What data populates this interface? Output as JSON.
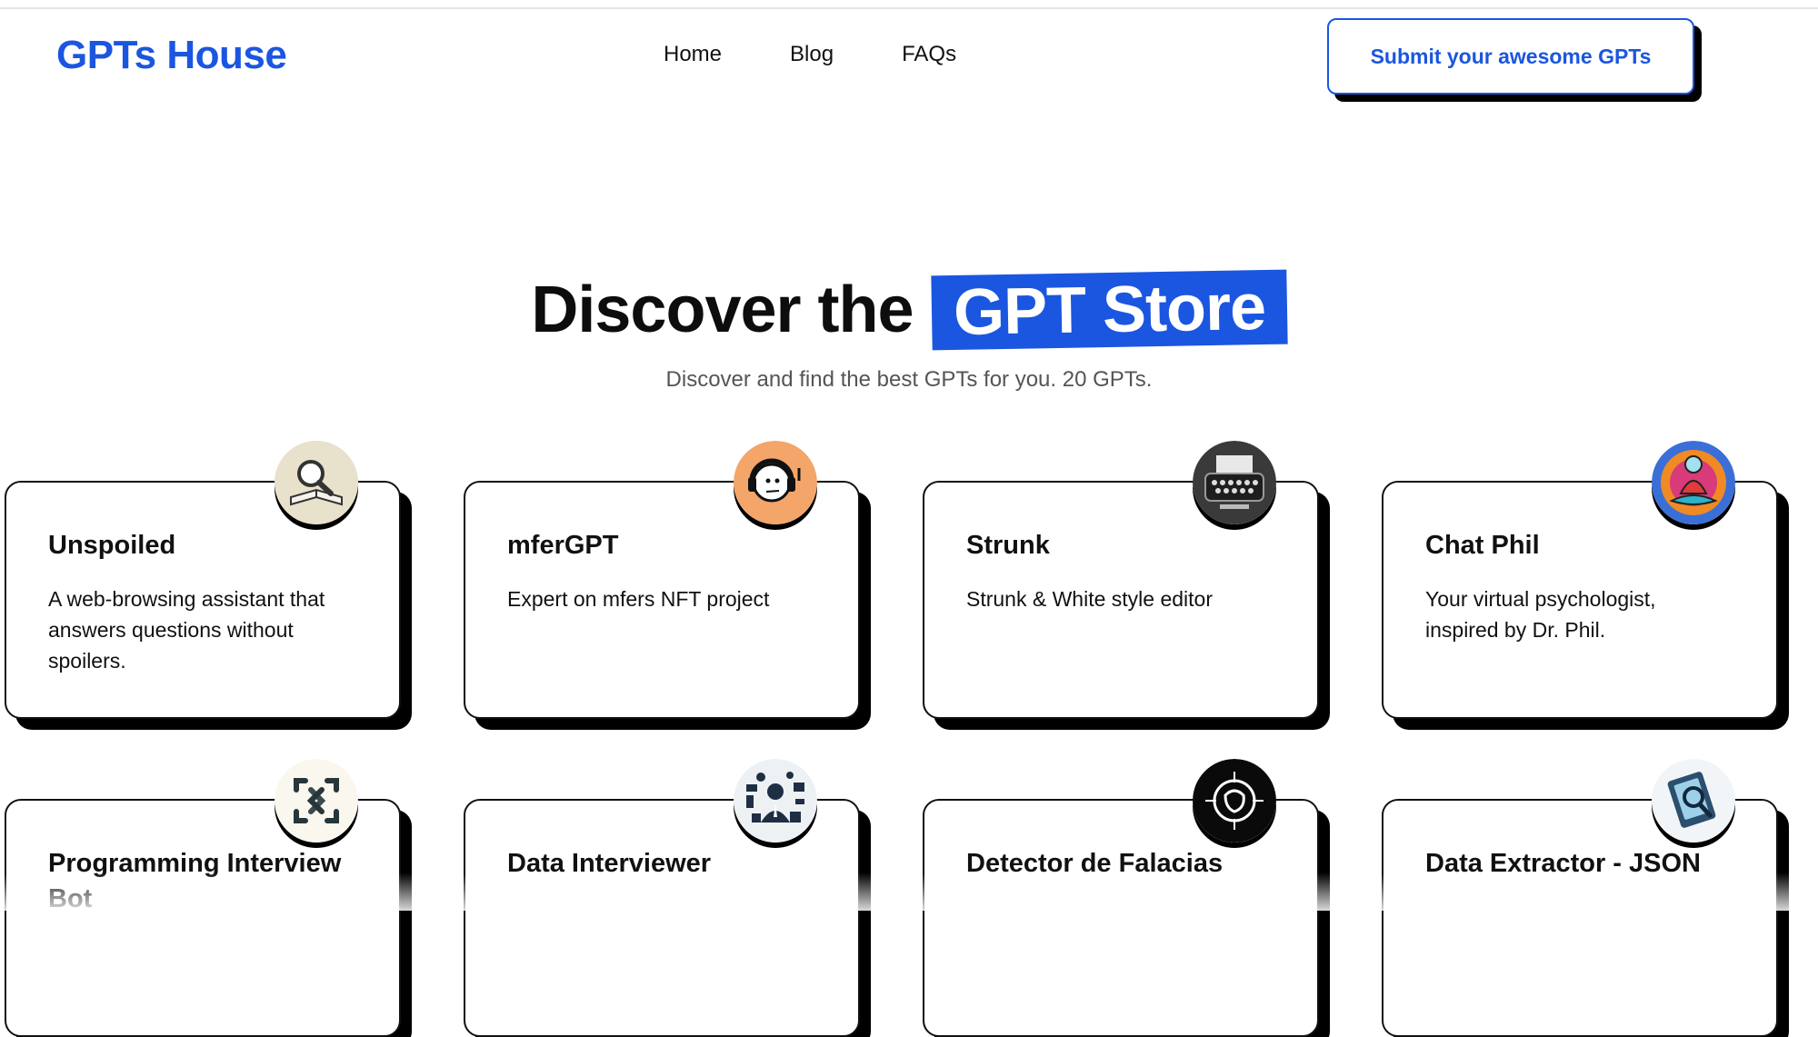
{
  "brand": {
    "name": "GPTs House",
    "color": "#1b56e0"
  },
  "nav": {
    "items": [
      "Home",
      "Blog",
      "FAQs"
    ]
  },
  "header": {
    "submit_label": "Submit your awesome GPTs"
  },
  "hero": {
    "title_prefix": "Discover the",
    "title_highlight": "GPT Store",
    "subtitle": "Discover and find the best GPTs for you. 20 GPTs."
  },
  "cards": [
    {
      "title": "Unspoiled",
      "description": "A web-browsing assistant that answers questions without spoilers.",
      "icon": "book-magnifier-icon"
    },
    {
      "title": "mferGPT",
      "description": "Expert on mfers NFT project",
      "icon": "headphones-mfer-icon"
    },
    {
      "title": "Strunk",
      "description": "Strunk & White style editor",
      "icon": "typewriter-icon"
    },
    {
      "title": "Chat Phil",
      "description": "Your virtual psychologist, inspired by Dr. Phil.",
      "icon": "meditating-figure-icon"
    },
    {
      "title": "Programming Interview Bot",
      "description": "",
      "icon": "code-scan-icon"
    },
    {
      "title": "Data Interviewer",
      "description": "",
      "icon": "data-collage-icon"
    },
    {
      "title": "Detector de Falacias",
      "description": "",
      "icon": "target-fallacy-icon"
    },
    {
      "title": "Data Extractor - JSON",
      "description": "",
      "icon": "document-search-icon"
    }
  ],
  "colors": {
    "accent": "#1b56e0",
    "card_shadow": "#000000",
    "subtitle": "#555555"
  }
}
